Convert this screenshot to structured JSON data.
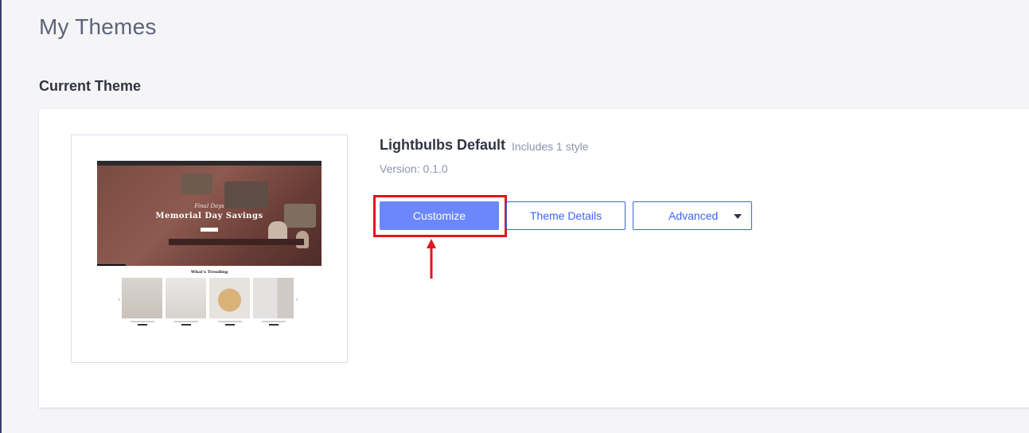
{
  "page": {
    "title": "My Themes",
    "section_title": "Current Theme"
  },
  "theme": {
    "name": "Lightbulbs Default",
    "styles_note": "Includes 1 style",
    "version": "Version: 0.1.0",
    "preview": {
      "hero_subtitle": "Final Days",
      "hero_headline": "Memorial Day Savings",
      "trending_title": "What's Trending"
    }
  },
  "actions": {
    "customize_label": "Customize",
    "details_label": "Theme Details",
    "advanced_label": "Advanced"
  },
  "colors": {
    "primary": "#3c64f4",
    "customize_bg": "#6b87fb",
    "highlight": "#e0151b",
    "page_bg": "#f5f5f7"
  }
}
